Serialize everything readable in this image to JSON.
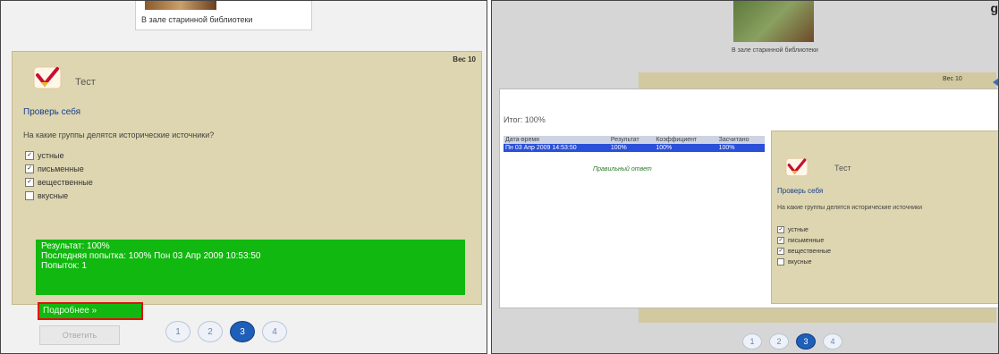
{
  "left": {
    "library_caption": "В зале старинной библиотеки",
    "ves_label": "Вес 10",
    "test_title": "Тест",
    "check_title": "Проверь себя",
    "question": "На какие группы делятся исторические источники?",
    "options": [
      {
        "label": "устные",
        "checked": true
      },
      {
        "label": "письменные",
        "checked": true
      },
      {
        "label": "вещественные",
        "checked": true
      },
      {
        "label": "вкусные",
        "checked": false
      }
    ],
    "result_lines": [
      "Результат: 100%",
      "Последняя попытка: 100% Пон 03 Апр 2009 10:53:50",
      "Попыток: 1"
    ],
    "details_link": "Подробнее »",
    "check_button": "Ответить",
    "pager": [
      "1",
      "2",
      "3",
      "4"
    ],
    "pager_active": 2
  },
  "right": {
    "library_caption": "В зале старинной библиотеки",
    "ves_label": "Вес 10",
    "itog": "Итог: 100%",
    "table_headers": [
      "Дата-время",
      "Результат",
      "Коэффициент",
      "Засчитано"
    ],
    "table_row": [
      "Пн 03 Апр 2009 14:53:50",
      "100%",
      "100%",
      "100%"
    ],
    "correct_answer": "Правильный ответ",
    "test_title": "Тест",
    "check_title": "Проверь себя",
    "question": "На какие группы делятся исторические источники",
    "options": [
      {
        "label": "устные",
        "checked": true
      },
      {
        "label": "письменные",
        "checked": true
      },
      {
        "label": "вещественные",
        "checked": true
      },
      {
        "label": "вкусные",
        "checked": false
      }
    ],
    "corner_letter": "g",
    "pager": [
      "1",
      "2",
      "3",
      "4"
    ],
    "pager_active": 2
  },
  "colors": {
    "quiz_bg": "#ddd6b0",
    "result_green": "#11b80f",
    "highlight_red": "#e01010",
    "pager_active": "#1f5fb8",
    "table_row_blue": "#2a4fd8"
  },
  "icons": {
    "test_logo": "checkmark-logo-icon",
    "arrow": "arrow-left-icon"
  }
}
